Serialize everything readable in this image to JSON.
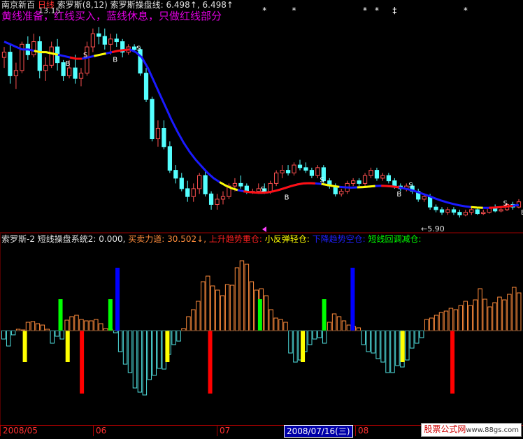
{
  "header": {
    "title": "南京新百",
    "period": "日线",
    "indicator": "索罗斯(8,12)",
    "line_label": "索罗斯操盘线: 6.498↑, 6.498↑",
    "subtitle": "黄线准备，红线买入，蓝线休息，只做红线部分",
    "high_label": "13.15",
    "low_label": "←5.90"
  },
  "lower_header": {
    "name": "索罗斯-2",
    "sys": "短线操盘系统2: 0.000,",
    "force": "买卖力道: 30.502↓,",
    "up": "上升趋势重仓:",
    "rebound": "小反弹轻仓:",
    "down": "下降趋势空仓:",
    "pullback": "短线回调减仓:"
  },
  "xaxis": {
    "ticks": [
      "2008/05",
      "06",
      "07",
      "2008/07/16(三)",
      "08"
    ]
  },
  "watermark": {
    "main": "股票公式网",
    "url": "www.88gs.com"
  },
  "colors": {
    "up_candle": "#ff5050",
    "down_candle": "#54ffff",
    "blue_line": "#1a1aff",
    "red_line": "#ff1010",
    "yellow_line": "#ffff00",
    "pos_bar": "#ff8c3c",
    "neg_bar": "#50e0e0",
    "green": "#00ff00",
    "blue": "#0000ff",
    "yellow": "#ffff00",
    "red": "#ff0000"
  },
  "chart_data": [
    {
      "type": "candlestick",
      "title": "南京新百 日线",
      "candles": [
        [
          12.0,
          12.4,
          11.6,
          12.2
        ],
        [
          12.2,
          12.5,
          11.0,
          11.3
        ],
        [
          11.3,
          11.8,
          10.8,
          11.5
        ],
        [
          11.5,
          12.6,
          11.4,
          12.5
        ],
        [
          12.5,
          12.8,
          11.9,
          12.1
        ],
        [
          12.1,
          12.9,
          12.0,
          12.6
        ],
        [
          12.6,
          12.8,
          11.2,
          11.5
        ],
        [
          11.5,
          12.0,
          11.1,
          11.7
        ],
        [
          11.7,
          12.6,
          11.6,
          12.4
        ],
        [
          12.4,
          12.7,
          11.5,
          11.8
        ],
        [
          11.8,
          11.9,
          11.1,
          11.3
        ],
        [
          11.3,
          11.9,
          11.2,
          11.6
        ],
        [
          11.6,
          12.1,
          11.0,
          11.2
        ],
        [
          11.2,
          11.6,
          10.9,
          11.4
        ],
        [
          11.4,
          12.6,
          11.3,
          12.4
        ],
        [
          12.4,
          13.1,
          12.2,
          12.9
        ],
        [
          12.9,
          13.15,
          12.5,
          12.8
        ],
        [
          12.8,
          13.1,
          12.3,
          12.5
        ],
        [
          12.5,
          12.9,
          12.1,
          12.7
        ],
        [
          12.7,
          12.9,
          12.4,
          12.6
        ],
        [
          12.6,
          12.7,
          12.0,
          12.2
        ],
        [
          12.2,
          12.5,
          12.1,
          12.4
        ],
        [
          12.4,
          12.5,
          12.2,
          12.3
        ],
        [
          12.3,
          12.4,
          11.3,
          11.4
        ],
        [
          11.4,
          11.6,
          10.3,
          10.4
        ],
        [
          10.4,
          10.5,
          8.8,
          8.9
        ],
        [
          8.9,
          9.6,
          8.6,
          9.3
        ],
        [
          9.3,
          9.6,
          8.5,
          8.6
        ],
        [
          8.6,
          8.8,
          7.6,
          7.7
        ],
        [
          7.7,
          7.9,
          7.2,
          7.4
        ],
        [
          7.4,
          7.6,
          6.9,
          7.0
        ],
        [
          7.0,
          7.3,
          6.5,
          6.7
        ],
        [
          6.7,
          7.2,
          6.5,
          7.0
        ],
        [
          7.0,
          7.6,
          6.8,
          7.5
        ],
        [
          7.5,
          7.7,
          6.7,
          6.8
        ],
        [
          6.8,
          6.9,
          6.2,
          6.4
        ],
        [
          6.4,
          6.8,
          6.2,
          6.6
        ],
        [
          6.6,
          6.9,
          6.4,
          6.7
        ],
        [
          6.7,
          7.2,
          6.6,
          7.1
        ],
        [
          7.1,
          7.4,
          6.9,
          7.2
        ],
        [
          7.2,
          7.5,
          7.0,
          7.1
        ],
        [
          7.1,
          7.2,
          6.8,
          6.9
        ],
        [
          6.9,
          7.0,
          6.8,
          6.9
        ],
        [
          6.9,
          7.2,
          6.8,
          7.0
        ],
        [
          7.0,
          7.2,
          6.8,
          6.9
        ],
        [
          6.9,
          7.3,
          6.8,
          7.2
        ],
        [
          7.2,
          7.7,
          7.1,
          7.6
        ],
        [
          7.6,
          7.9,
          7.4,
          7.7
        ],
        [
          7.7,
          7.9,
          7.5,
          7.6
        ],
        [
          7.6,
          8.0,
          7.5,
          7.9
        ],
        [
          7.9,
          8.1,
          7.7,
          7.8
        ],
        [
          7.8,
          8.0,
          7.6,
          7.7
        ],
        [
          7.7,
          7.8,
          7.4,
          7.5
        ],
        [
          7.5,
          7.9,
          7.4,
          7.8
        ],
        [
          7.8,
          7.9,
          7.2,
          7.3
        ],
        [
          7.3,
          7.4,
          7.0,
          7.1
        ],
        [
          7.1,
          7.2,
          6.7,
          6.8
        ],
        [
          6.8,
          7.0,
          6.7,
          6.9
        ],
        [
          6.9,
          7.3,
          6.8,
          7.2
        ],
        [
          7.2,
          7.4,
          7.1,
          7.3
        ],
        [
          7.3,
          7.4,
          7.1,
          7.2
        ],
        [
          7.2,
          7.6,
          7.1,
          7.5
        ],
        [
          7.5,
          7.8,
          7.4,
          7.7
        ],
        [
          7.7,
          7.8,
          7.3,
          7.4
        ],
        [
          7.4,
          7.6,
          7.3,
          7.5
        ],
        [
          7.5,
          7.6,
          7.2,
          7.3
        ],
        [
          7.3,
          7.4,
          7.0,
          7.1
        ],
        [
          7.1,
          7.2,
          6.9,
          7.0
        ],
        [
          7.0,
          7.2,
          6.9,
          7.1
        ],
        [
          7.1,
          7.2,
          6.8,
          6.9
        ],
        [
          6.9,
          7.0,
          6.5,
          6.6
        ],
        [
          6.6,
          6.8,
          6.5,
          6.7
        ],
        [
          6.7,
          6.8,
          6.2,
          6.3
        ],
        [
          6.3,
          6.4,
          6.1,
          6.2
        ],
        [
          6.2,
          6.3,
          6.0,
          6.1
        ],
        [
          6.1,
          6.3,
          6.0,
          6.2
        ],
        [
          6.2,
          6.3,
          6.0,
          6.1
        ],
        [
          6.1,
          6.2,
          5.9,
          6.0
        ],
        [
          6.0,
          6.2,
          5.95,
          6.1
        ],
        [
          6.1,
          6.3,
          6.0,
          6.2
        ],
        [
          6.2,
          6.3,
          6.0,
          6.05
        ],
        [
          6.05,
          6.2,
          6.0,
          6.1
        ],
        [
          6.1,
          6.3,
          6.05,
          6.25
        ],
        [
          6.25,
          6.4,
          6.1,
          6.15
        ],
        [
          6.15,
          6.3,
          6.1,
          6.2
        ],
        [
          6.2,
          6.45,
          6.15,
          6.4
        ],
        [
          6.4,
          6.5,
          6.2,
          6.3
        ],
        [
          6.3,
          6.6,
          6.25,
          6.5
        ]
      ],
      "ma_line": [
        12.6,
        12.5,
        12.4,
        12.3,
        12.3,
        12.25,
        12.2,
        12.2,
        12.15,
        12.1,
        12.05,
        12.0,
        11.95,
        11.95,
        12.0,
        12.05,
        12.1,
        12.15,
        12.2,
        12.25,
        12.28,
        12.3,
        12.2,
        12.0,
        11.6,
        11.1,
        10.6,
        10.1,
        9.6,
        9.15,
        8.75,
        8.4,
        8.1,
        7.85,
        7.6,
        7.4,
        7.25,
        7.12,
        7.02,
        6.95,
        6.9,
        6.87,
        6.85,
        6.84,
        6.86,
        6.9,
        6.96,
        7.03,
        7.1,
        7.16,
        7.2,
        7.21,
        7.2,
        7.18,
        7.14,
        7.1,
        7.07,
        7.05,
        7.04,
        7.05,
        7.06,
        7.08,
        7.1,
        7.11,
        7.1,
        7.08,
        7.05,
        7.0,
        6.95,
        6.88,
        6.8,
        6.72,
        6.63,
        6.55,
        6.48,
        6.42,
        6.37,
        6.33,
        6.3,
        6.28,
        6.27,
        6.27,
        6.28,
        6.3,
        6.32,
        6.35,
        6.38
      ],
      "segments": [
        {
          "color": "yellow",
          "from": 5,
          "to": 9
        },
        {
          "color": "red",
          "from": 11,
          "to": 13
        },
        {
          "color": "yellow",
          "from": 15,
          "to": 17
        },
        {
          "color": "red",
          "from": 18,
          "to": 21
        },
        {
          "color": "yellow",
          "from": 36,
          "to": 39
        },
        {
          "color": "red",
          "from": 40,
          "to": 53
        },
        {
          "color": "yellow",
          "from": 54,
          "to": 57
        },
        {
          "color": "yellow",
          "from": 60,
          "to": 63
        },
        {
          "color": "red",
          "from": 64,
          "to": 67
        },
        {
          "color": "yellow",
          "from": 79,
          "to": 81
        },
        {
          "color": "red",
          "from": 82,
          "to": 86
        }
      ],
      "signals": [
        {
          "i": 10,
          "label": "B"
        },
        {
          "i": 13,
          "label": "S"
        },
        {
          "i": 18,
          "label": "B"
        },
        {
          "i": 22,
          "label": "S"
        },
        {
          "i": 43,
          "label": "S"
        },
        {
          "i": 47,
          "label": "B"
        },
        {
          "i": 53,
          "label": "S"
        },
        {
          "i": 66,
          "label": "B"
        },
        {
          "i": 68,
          "label": "S"
        },
        {
          "i": 84,
          "label": "S"
        },
        {
          "i": 87,
          "label": "B"
        }
      ],
      "stars": [
        {
          "i": 44,
          "glyph": "*"
        },
        {
          "i": 49,
          "glyph": "*"
        },
        {
          "i": 61,
          "glyph": "*"
        },
        {
          "i": 63,
          "glyph": "*"
        },
        {
          "i": 66,
          "glyph": "‡"
        },
        {
          "i": 78,
          "glyph": "*"
        }
      ],
      "ylim": [
        5.4,
        13.6
      ]
    },
    {
      "type": "bar",
      "title": "短线操盘系统2",
      "values": [
        -12,
        -22,
        -6,
        2,
        1,
        12,
        13,
        10,
        8,
        2,
        -18,
        -8,
        -12,
        15,
        20,
        22,
        16,
        14,
        14,
        16,
        10,
        3,
        2,
        -3,
        -30,
        -48,
        -60,
        -82,
        -88,
        -92,
        -70,
        -64,
        -54,
        -55,
        -34,
        -20,
        -15,
        3,
        20,
        30,
        42,
        70,
        78,
        64,
        58,
        50,
        66,
        65,
        90,
        100,
        95,
        70,
        58,
        60,
        50,
        30,
        18,
        16,
        12,
        -32,
        -45,
        -42,
        -30,
        -20,
        -12,
        -10,
        -18,
        12,
        24,
        20,
        14,
        8,
        6,
        4,
        -20,
        -30,
        -32,
        -40,
        -45,
        -60,
        -60,
        -50,
        -52,
        -42,
        -25,
        -18,
        -10,
        16,
        18,
        22,
        26,
        28,
        32,
        30,
        36,
        42,
        36,
        44,
        60,
        45,
        34,
        40,
        48,
        44,
        52,
        62,
        54
      ],
      "markers": [
        {
          "i": 3,
          "dir": "down",
          "color": "yellow",
          "size": 45
        },
        {
          "i": 8,
          "dir": "up",
          "color": "green",
          "size": 45
        },
        {
          "i": 9,
          "dir": "down",
          "color": "yellow",
          "size": 45
        },
        {
          "i": 11,
          "dir": "down",
          "color": "red",
          "size": 90
        },
        {
          "i": 15,
          "dir": "up",
          "color": "green",
          "size": 45
        },
        {
          "i": 16,
          "dir": "up",
          "color": "blue",
          "size": 90
        },
        {
          "i": 23,
          "dir": "down",
          "color": "yellow",
          "size": 45
        },
        {
          "i": 29,
          "dir": "down",
          "color": "red",
          "size": 90
        },
        {
          "i": 36,
          "dir": "up",
          "color": "green",
          "size": 45
        },
        {
          "i": 42,
          "dir": "down",
          "color": "yellow",
          "size": 45
        },
        {
          "i": 45,
          "dir": "up",
          "color": "green",
          "size": 45
        },
        {
          "i": 49,
          "dir": "up",
          "color": "blue",
          "size": 90
        },
        {
          "i": 56,
          "dir": "down",
          "color": "yellow",
          "size": 45
        },
        {
          "i": 63,
          "dir": "down",
          "color": "red",
          "size": 90
        }
      ],
      "ylim": [
        -135,
        100
      ]
    }
  ]
}
